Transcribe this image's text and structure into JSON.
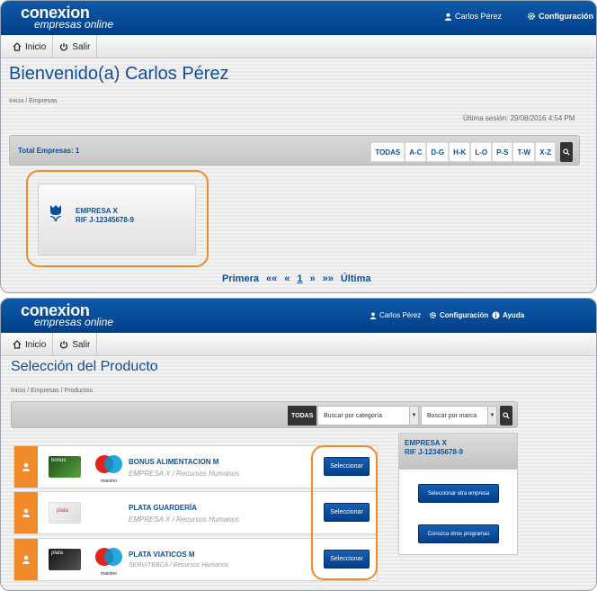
{
  "brand": {
    "line1": "conexion",
    "line2": "empresas online"
  },
  "screen1": {
    "user": "Carlos Pérez",
    "config": "Configuración",
    "nav": [
      {
        "label": "Inicio"
      },
      {
        "label": "Salir"
      }
    ],
    "title": "Bienvenido(a) Carlos Pérez",
    "breadcrumb": "Inicio / Empresas",
    "last_session": "Última sesión: 29/08/2016 4:54 PM",
    "total": "Total Empresas: 1",
    "letters": [
      "TODAS",
      "A-C",
      "D-G",
      "H-K",
      "L-O",
      "P-S",
      "T-W",
      "X-Z"
    ],
    "company": {
      "name": "EMPRESA X",
      "rif": "RIF J-12345678-9"
    },
    "pager": {
      "first": "Primera",
      "prev2": "««",
      "prev": "«",
      "page": "1",
      "next": "»",
      "next2": "»»",
      "last": "Última"
    }
  },
  "screen2": {
    "user": "Carlos Pérez",
    "config": "Configuración",
    "help": "Ayuda",
    "nav": [
      {
        "label": "Inicio"
      },
      {
        "label": "Salir"
      }
    ],
    "title": "Selección del Producto",
    "breadcrumb": "Inicio / Empresas / Productos",
    "filter": {
      "all": "TODAS",
      "category_placeholder": "Buscar por categoría",
      "brand_placeholder": "Buscar por marca"
    },
    "products": [
      {
        "name": "BONUS ALIMENTACION M",
        "sub": "EMPRESA X / Recursos Humanos",
        "button": "Seleccionar",
        "card_label": "bonus",
        "network": "maestro"
      },
      {
        "name": "PLATA GUARDERÍA",
        "sub": "EMPRESA X / Recursos Humanos",
        "button": "Seleccionar",
        "card_label": "plata",
        "network": ""
      },
      {
        "name": "PLATA VIATICOS M",
        "sub": "SERVITEBCA / Recursos Humanos",
        "button": "Seleccionar",
        "card_label": "plata",
        "network": "maestro"
      }
    ],
    "company_box": {
      "name": "EMPRESA X",
      "rif": "RIF J-12345678-9",
      "btn1": "Seleccionar otra empresa",
      "btn2": "Conozca otros programas"
    }
  },
  "colors": {
    "primary": "#003f8a",
    "link": "#0d4f9c",
    "accent": "#f08a2a"
  }
}
